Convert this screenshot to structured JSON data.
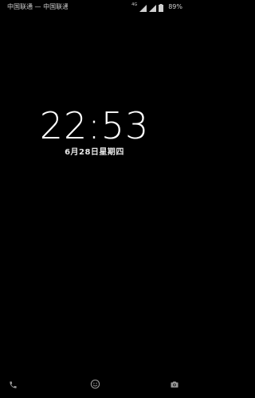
{
  "status_bar": {
    "carrier_text": "中国联通 — 中国联通",
    "network_type": "4G",
    "battery_level": "89%"
  },
  "lock_screen": {
    "time": "22:53",
    "date": "6月28日星期四"
  },
  "shortcuts": {
    "left_icon": "phone-icon",
    "center_icon": "face-icon",
    "right_icon": "camera-icon"
  },
  "colors": {
    "background": "#000000",
    "text": "#ffffff",
    "muted": "#9a9a9a"
  }
}
